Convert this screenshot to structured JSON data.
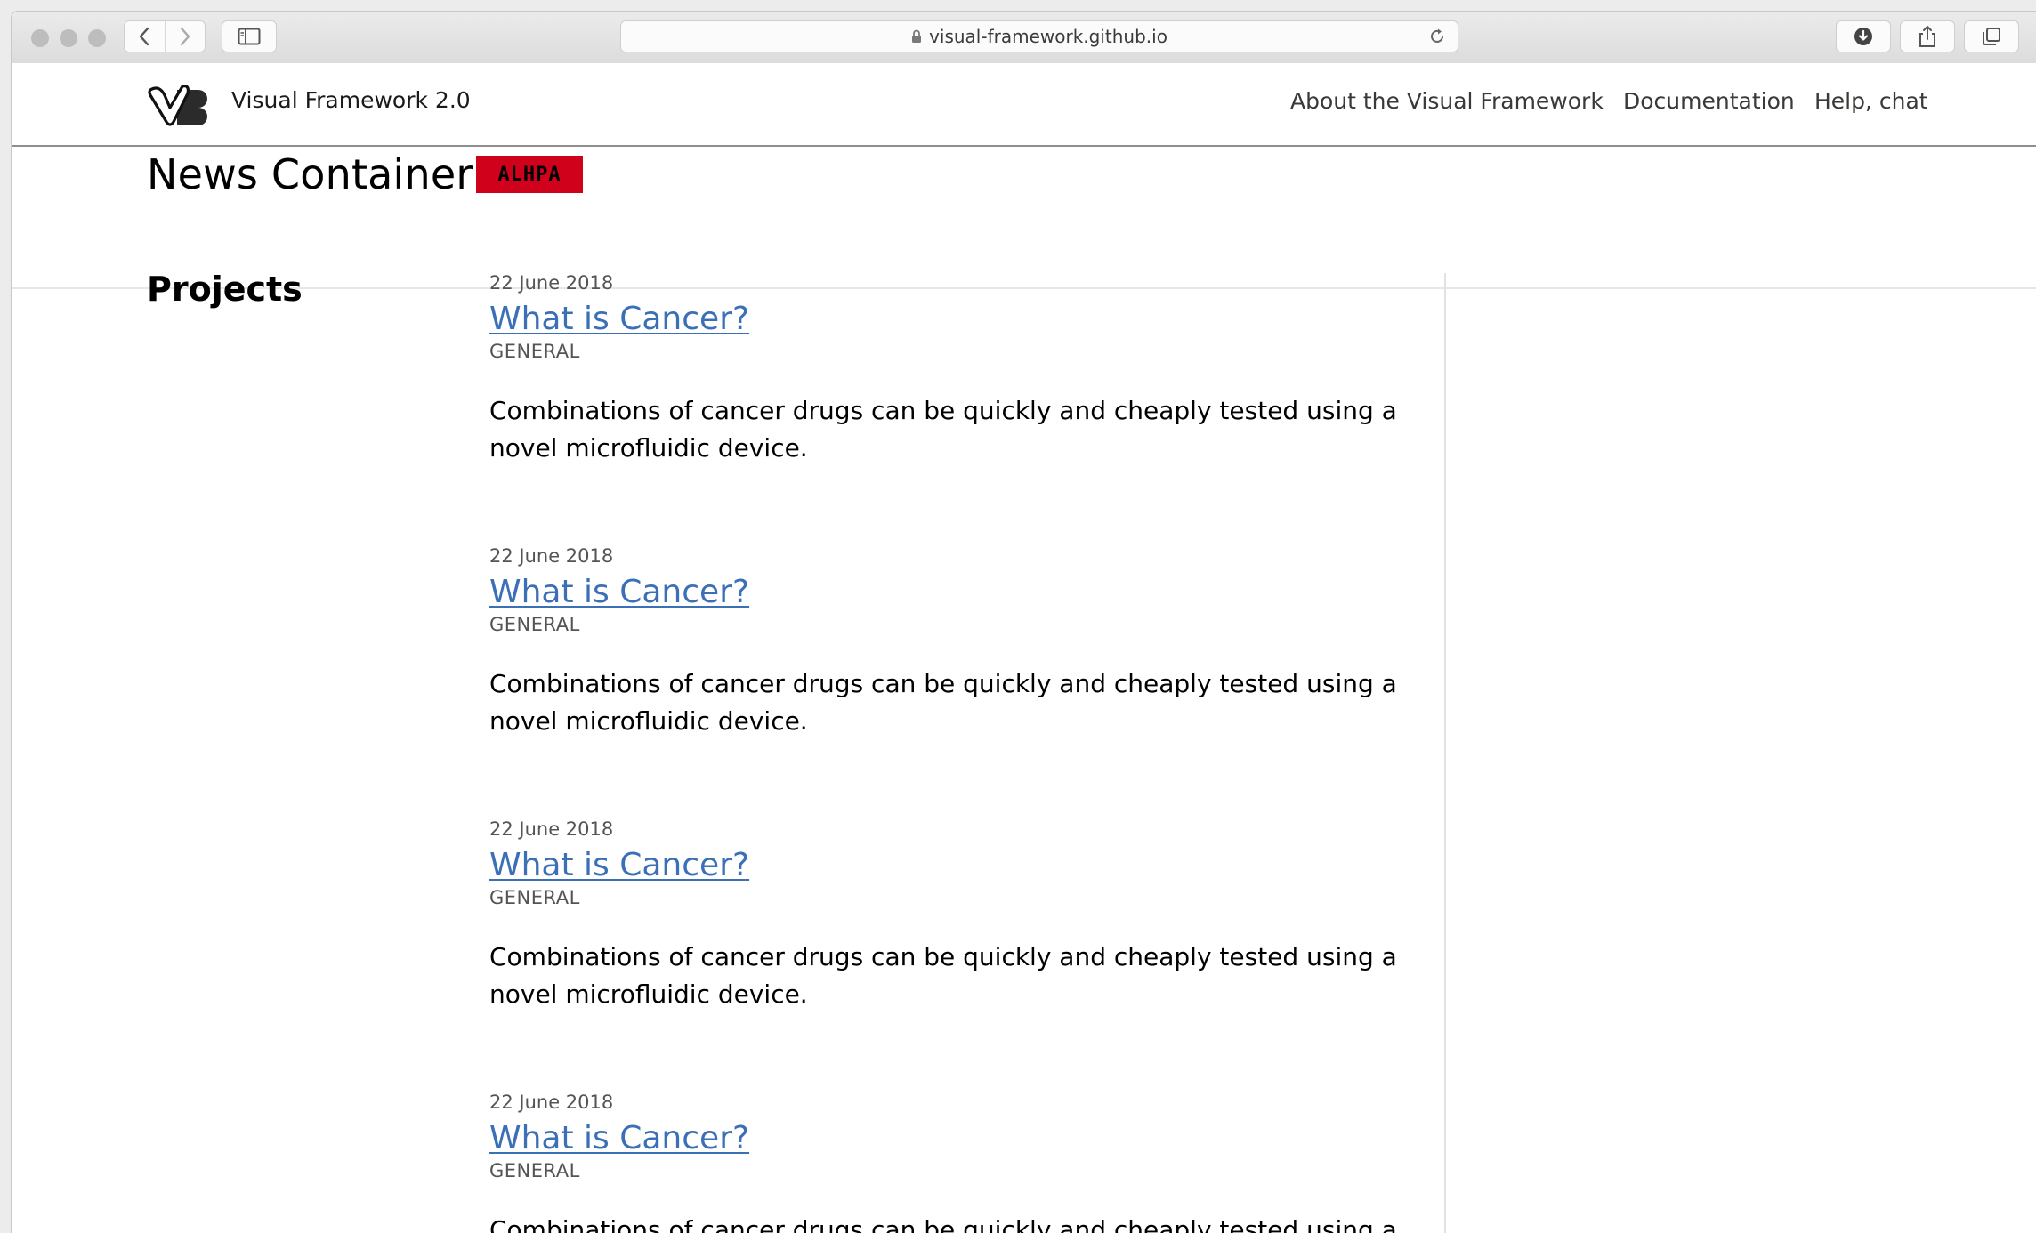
{
  "browser": {
    "url": "visual-framework.github.io"
  },
  "site": {
    "name": "Visual Framework 2.0",
    "nav": [
      {
        "label": "About the Visual Framework"
      },
      {
        "label": "Documentation"
      },
      {
        "label": "Help, chat"
      }
    ]
  },
  "page": {
    "title": "News Container",
    "badge": "ALHPA",
    "badge_color": "#d0021b",
    "section_label": "Projects",
    "link_color": "#3b6fb6"
  },
  "news": [
    {
      "date": "22 June 2018",
      "headline": "What is Cancer?",
      "category": "GENERAL",
      "summary": "Combinations of cancer drugs can be quickly and cheaply tested using a novel microfluidic device."
    },
    {
      "date": "22 June 2018",
      "headline": "What is Cancer?",
      "category": "GENERAL",
      "summary": "Combinations of cancer drugs can be quickly and cheaply tested using a novel microfluidic device."
    },
    {
      "date": "22 June 2018",
      "headline": "What is Cancer?",
      "category": "GENERAL",
      "summary": "Combinations of cancer drugs can be quickly and cheaply tested using a novel microfluidic device."
    },
    {
      "date": "22 June 2018",
      "headline": "What is Cancer?",
      "category": "GENERAL",
      "summary": "Combinations of cancer drugs can be quickly and cheaply tested using a novel microfluidic device."
    }
  ]
}
